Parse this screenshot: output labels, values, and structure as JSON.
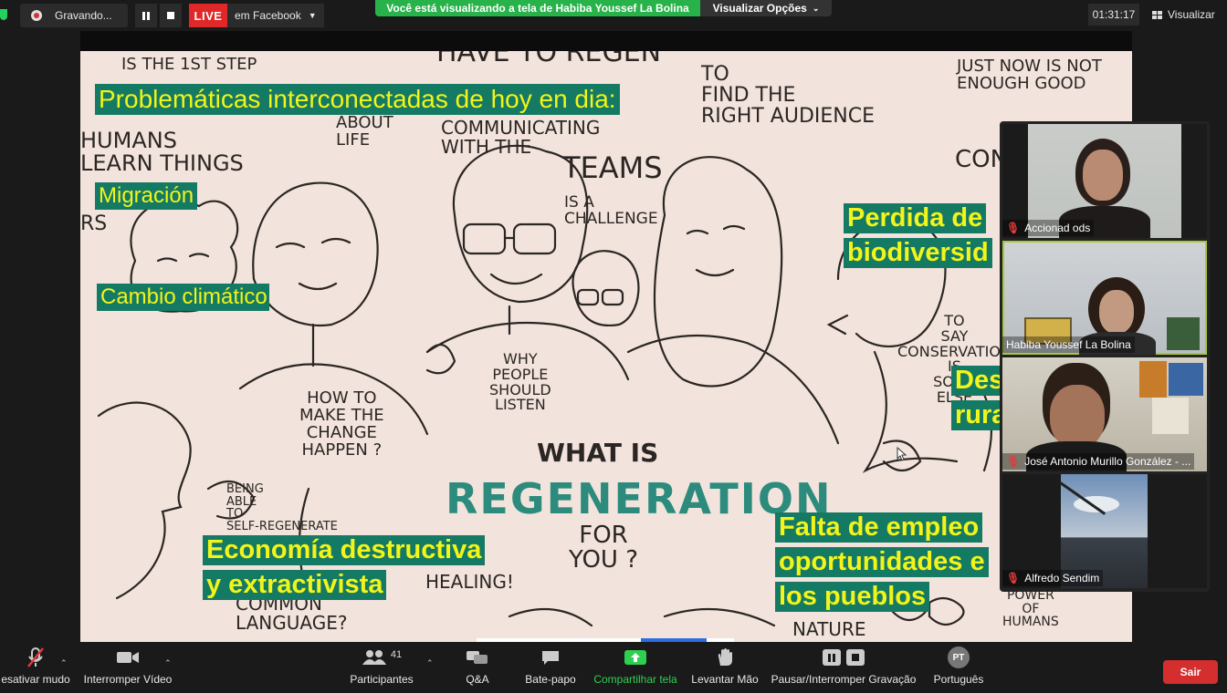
{
  "recording": {
    "label": "Gravando..."
  },
  "live": {
    "badge": "LIVE",
    "platform": "em Facebook"
  },
  "share_banner": {
    "text": "Você está visualizando a tela de Habiba Youssef La Bolina",
    "options": "Visualizar Opções"
  },
  "timer": "01:31:17",
  "view_button": "Visualizar",
  "slide": {
    "title": "Problemáticas interconectadas de hoy en dia:",
    "items": {
      "migracion": "Migración",
      "cambio": "Cambio climático",
      "perdida_1": "Perdida de",
      "perdida_2": "biodiversid",
      "des_1": "Des",
      "des_2": "rura",
      "economia_1": "Economía destructiva",
      "economia_2": "y extractivista",
      "falta_1": "Falta de empleo",
      "falta_2": "oportunidades e",
      "falta_3": "los pueblos"
    },
    "doodles": {
      "have_to": "HAVE TO REGEN",
      "is_the": "IS THE 1st STEP",
      "about_life": "ABOUT\nLIFE",
      "communicating": "COMMUNICATING\nWITH THE",
      "teams": "TEAMS",
      "is_a": "IS A\nCHALLENGE",
      "find": "TO\nFIND THE\nRIGHT AUDIENCE",
      "just_now": "JUST NOW IS NOT\nENOUGH GOOD",
      "humans": "HUMANS\nLEARN THINGS",
      "rs": "RS",
      "con": "CON",
      "how_to": "HOW TO\nMAKE THE\nCHANGE\nHAPPEN ?",
      "why_people": "WHY\nPEOPLE\nSHOULD\nLISTEN",
      "what_is": "WHAT IS",
      "regeneration": "REGENERATION",
      "for_you": "FOR\nYOU ?",
      "to_say": "TO\nSAY\nCONSERVATION\nIS\nSOME\nELSE",
      "being_able": "BEING\nABLE\nTO\nSELF-REGENERATE",
      "healing": "HEALING!",
      "language": "COMMON\nLANGUAGE?",
      "nature": "NATURE",
      "power": "POWER\nOF\nHUMANS"
    }
  },
  "participants": [
    {
      "name": "Accionad ods",
      "muted": true,
      "active": false
    },
    {
      "name": "Habiba Youssef La Bolina",
      "muted": false,
      "active": true
    },
    {
      "name": "José Antonio Murillo González - ...",
      "muted": true,
      "active": false
    },
    {
      "name": "Alfredo Sendim",
      "muted": true,
      "active": false
    }
  ],
  "toolbar": {
    "mute": "esativar mudo",
    "video": "Interromper Vídeo",
    "participants": "Participantes",
    "participants_count": "41",
    "qa": "Q&A",
    "chat": "Bate-papo",
    "share": "Compartilhar tela",
    "raise_hand": "Levantar Mão",
    "recording": "Pausar/Interromper Gravação",
    "language_badge": "PT",
    "language": "Português",
    "leave": "Sair"
  },
  "colors": {
    "caption_bg": "#157a63",
    "caption_text": "#f2f41a",
    "banner_green": "#27b24a",
    "live_red": "#e02828",
    "active_outline": "#a6c93a",
    "share_green": "#2fd052",
    "leave_red": "#d42e2e",
    "regeneration_teal": "#2c8b7d"
  },
  "icons": [
    "shield-icon",
    "record-icon",
    "pause-icon",
    "stop-icon",
    "caret-down-icon",
    "grid-icon",
    "mic-off-icon",
    "video-camera-icon",
    "people-icon",
    "qa-icon",
    "chat-icon",
    "share-screen-icon",
    "hand-icon",
    "pause-recording-icon",
    "stop-recording-icon",
    "cursor-icon"
  ]
}
